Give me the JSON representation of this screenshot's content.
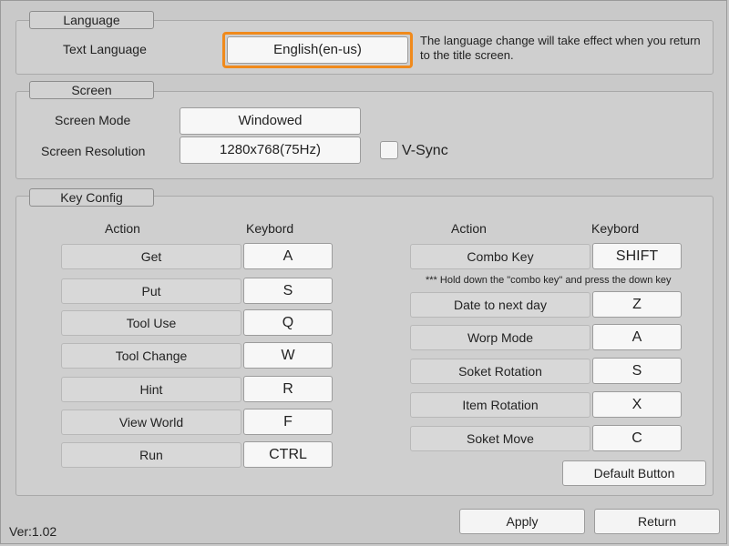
{
  "language": {
    "section_label": "Language",
    "text_language_label": "Text Language",
    "text_language_value": "English(en-us)",
    "note": "The language change will take effect when you return to the title screen."
  },
  "screen": {
    "section_label": "Screen",
    "mode_label": "Screen Mode",
    "mode_value": "Windowed",
    "resolution_label": "Screen Resolution",
    "resolution_value": "1280x768(75Hz)",
    "vsync_label": "V-Sync",
    "vsync_checked": false
  },
  "key_config": {
    "section_label": "Key Config",
    "action_header": "Action",
    "keyboard_header": "Keybord",
    "left": [
      {
        "action": "Get",
        "key": "A"
      },
      {
        "action": "Put",
        "key": "S"
      },
      {
        "action": "Tool Use",
        "key": "Q"
      },
      {
        "action": "Tool Change",
        "key": "W"
      },
      {
        "action": "Hint",
        "key": "R"
      },
      {
        "action": "View World",
        "key": "F"
      },
      {
        "action": "Run",
        "key": "CTRL"
      }
    ],
    "combo": {
      "action": "Combo Key",
      "key": "SHIFT"
    },
    "combo_note": "*** Hold down the \"combo key\" and press the down key",
    "right": [
      {
        "action": "Date to next day",
        "key": "Z"
      },
      {
        "action": "Worp Mode",
        "key": "A"
      },
      {
        "action": "Soket Rotation",
        "key": "S"
      },
      {
        "action": "Item Rotation",
        "key": "X"
      },
      {
        "action": "Soket Move",
        "key": "C"
      }
    ],
    "default_button": "Default Button"
  },
  "footer": {
    "version": "Ver:1.02",
    "apply": "Apply",
    "return": "Return"
  },
  "colors": {
    "background": "#c9c9c9",
    "focus_outline": "#f08a1c"
  }
}
